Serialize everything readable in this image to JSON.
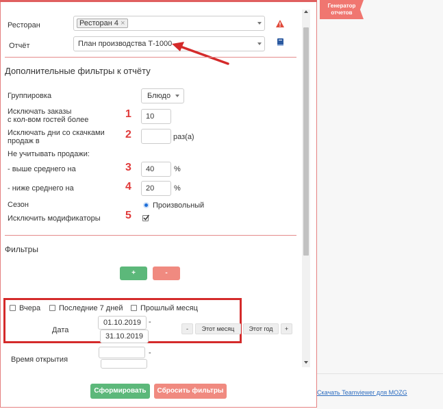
{
  "header": {
    "generator_tab": "Генератор отчетов",
    "teamviewer_link": "Скачать Teamviewer для MOZG"
  },
  "report": {
    "restaurant_label": "Ресторан",
    "restaurant_tag": "Ресторан 4",
    "report_label": "Отчёт",
    "report_value": "План производства Т-1000"
  },
  "extra_filters": {
    "title": "Дополнительные фильтры к отчёту",
    "grouping_label": "Группировка",
    "grouping_value": "Блюдо",
    "exclude_orders_label_line1": "Исключать заказы",
    "exclude_orders_label_line2": "с кол-вом гостей более",
    "exclude_orders_value": "10",
    "exclude_days_label_line1": "Исключать дни со скачками",
    "exclude_days_label_line2": "продаж в",
    "exclude_days_value": "",
    "exclude_days_unit": "раз(а)",
    "ignore_sales_label": "Не учитывать продажи:",
    "above_avg_label": "- выше среднего на",
    "above_avg_value": "40",
    "below_avg_label": "- ниже среднего на",
    "below_avg_value": "20",
    "percent_unit": "%",
    "season_label": "Сезон",
    "season_option": "Произвольный",
    "exclude_modifiers_label": "Исключить модификаторы",
    "markers": [
      "1",
      "2",
      "3",
      "4",
      "5"
    ]
  },
  "filters": {
    "title": "Фильтры",
    "add_label": "+",
    "remove_label": "-",
    "yesterday_label": "Вчера",
    "last7_label": "Последние 7 дней",
    "last_month_label": "Прошлый месяц",
    "date_label": "Дата",
    "date_from": "01.10.2019",
    "date_to": "31.10.2019",
    "date_dash": "-",
    "minus_btn": "-",
    "this_month_btn": "Этот месяц",
    "this_year_btn": "Этот год",
    "plus_btn": "+",
    "open_time_label": "Время открытия"
  },
  "actions": {
    "generate_label": "Сформировать",
    "reset_label": "Сбросить фильтры"
  },
  "colors": {
    "accent_red": "#e03a3a",
    "green": "#5cb87a",
    "salmon": "#f08a80"
  }
}
